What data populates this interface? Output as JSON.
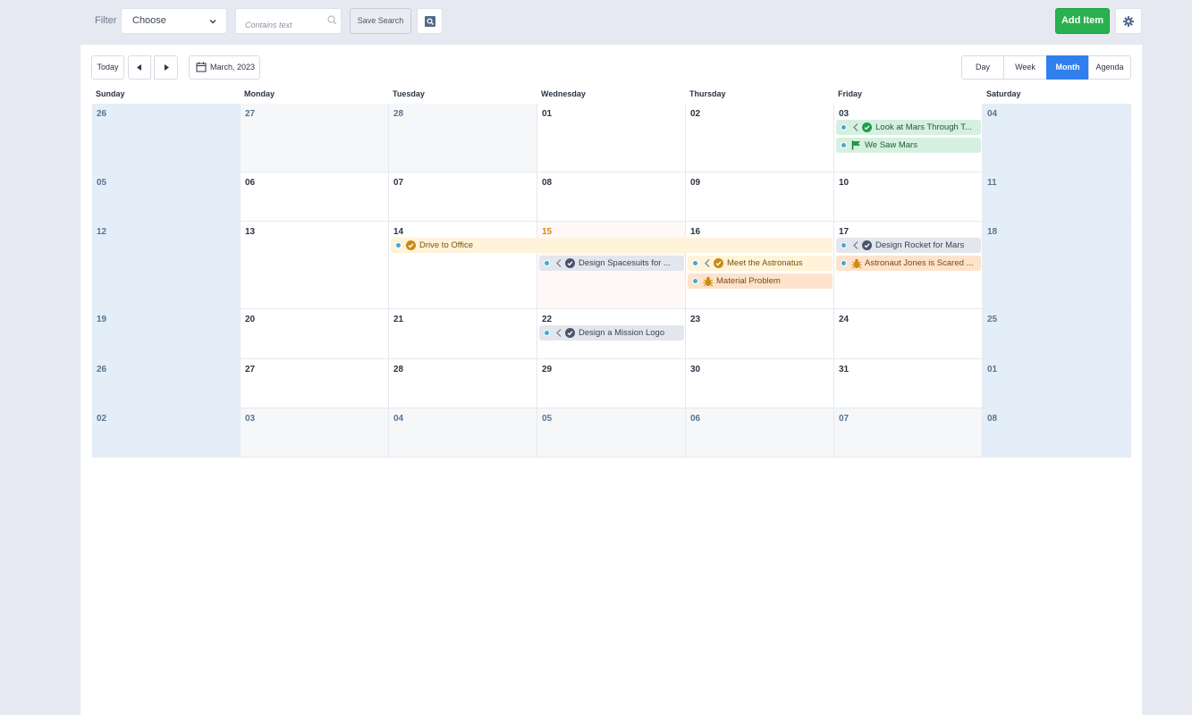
{
  "toolbar": {
    "filter_label": "Filter",
    "select_value": "Choose",
    "text_placeholder": "Contains text",
    "save_search": "Save Search",
    "add_item": "Add Item"
  },
  "nav": {
    "today": "Today",
    "date_label": "March, 2023",
    "views": [
      "Day",
      "Week",
      "Month",
      "Agenda"
    ],
    "active_view": "Month"
  },
  "weekdays": [
    "Sunday",
    "Monday",
    "Tuesday",
    "Wednesday",
    "Thursday",
    "Friday",
    "Saturday"
  ],
  "weeks": [
    [
      "26",
      "27",
      "28",
      "01",
      "02",
      "03",
      "04"
    ],
    [
      "05",
      "06",
      "07",
      "08",
      "09",
      "10",
      "11"
    ],
    [
      "12",
      "13",
      "14",
      "15",
      "16",
      "17",
      "18"
    ],
    [
      "19",
      "20",
      "21",
      "22",
      "23",
      "24",
      "25"
    ],
    [
      "26",
      "27",
      "28",
      "29",
      "30",
      "31",
      "01"
    ],
    [
      "02",
      "03",
      "04",
      "05",
      "06",
      "07",
      "08"
    ]
  ],
  "events": [
    {
      "title": "Look at Mars Through T...",
      "week": 0,
      "day": 5,
      "span": 1,
      "slot": 0,
      "style": "green",
      "icon": "check-circle",
      "continued": true
    },
    {
      "title": "We Saw Mars",
      "week": 0,
      "day": 5,
      "span": 1,
      "slot": 1,
      "style": "green",
      "icon": "flag",
      "continued": false
    },
    {
      "title": "Drive to Office",
      "week": 2,
      "day": 2,
      "span": 3,
      "slot": 0,
      "style": "yellow",
      "icon": "check-circle",
      "continued": false
    },
    {
      "title": "Design Rocket for Mars",
      "week": 2,
      "day": 5,
      "span": 1,
      "slot": 0,
      "style": "grey",
      "icon": "check-circle",
      "continued": true
    },
    {
      "title": "Design Spacesuits for ...",
      "week": 2,
      "day": 3,
      "span": 1,
      "slot": 1,
      "style": "grey",
      "icon": "check-circle",
      "continued": true
    },
    {
      "title": "Meet the Astronatus",
      "week": 2,
      "day": 4,
      "span": 1,
      "slot": 1,
      "style": "yellow",
      "icon": "check-circle",
      "continued": true
    },
    {
      "title": "Astronaut Jones is Scared ...",
      "week": 2,
      "day": 5,
      "span": 1,
      "slot": 1,
      "style": "orange",
      "icon": "bug",
      "continued": false
    },
    {
      "title": "Material Problem",
      "week": 2,
      "day": 4,
      "span": 1,
      "slot": 2,
      "style": "orange",
      "icon": "bug",
      "continued": false
    },
    {
      "title": "Design a Mission Logo",
      "week": 3,
      "day": 3,
      "span": 1,
      "slot": 0,
      "style": "grey",
      "icon": "check-circle",
      "continued": true
    }
  ],
  "colors": {
    "accent": "#2f80ed",
    "add_button": "#2bb04f",
    "event_dot": "#40a9d8",
    "today_number": "#d48a13"
  }
}
